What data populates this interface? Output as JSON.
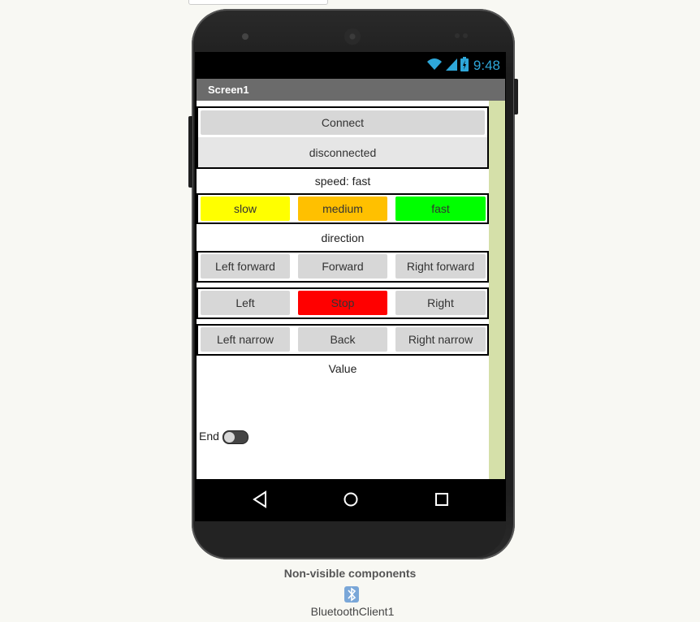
{
  "status_bar": {
    "time": "9:48"
  },
  "title_bar": {
    "title": "Screen1"
  },
  "connect": {
    "button_label": "Connect",
    "status_text": "disconnected"
  },
  "speed": {
    "label": "speed: fast",
    "buttons": [
      {
        "label": "slow",
        "color": "#ffff00"
      },
      {
        "label": "medium",
        "color": "#ffc000"
      },
      {
        "label": "fast",
        "color": "#00ff00"
      }
    ]
  },
  "direction": {
    "label": "direction",
    "rows": [
      [
        "Left forward",
        "Forward",
        "Right forward"
      ],
      [
        "Left",
        "Stop",
        "Right"
      ],
      [
        "Left narrow",
        "Back",
        "Right narrow"
      ]
    ],
    "stop_color": "#ff0000"
  },
  "value_label": "Value",
  "end_switch": {
    "label": "End",
    "on": false
  },
  "non_visible": {
    "title": "Non-visible components",
    "components": [
      {
        "name": "BluetoothClient1",
        "icon": "bluetooth-icon"
      }
    ]
  }
}
